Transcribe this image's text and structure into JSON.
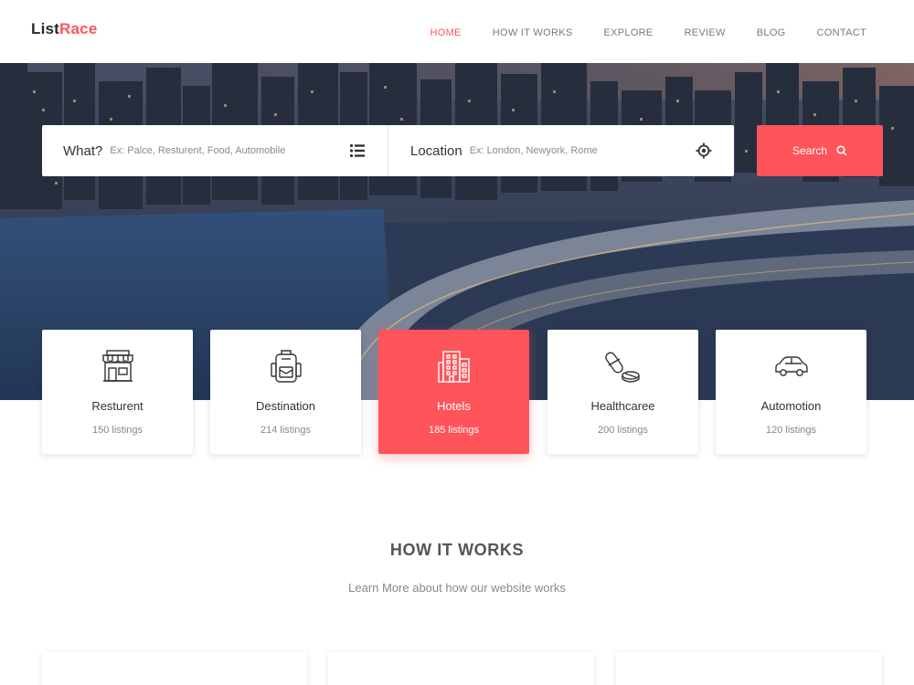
{
  "brand": {
    "part1": "List",
    "part2": "Race"
  },
  "nav": [
    {
      "label": "HOME",
      "active": true
    },
    {
      "label": "HOW IT WORKS",
      "active": false
    },
    {
      "label": "EXPLORE",
      "active": false
    },
    {
      "label": "REVIEW",
      "active": false
    },
    {
      "label": "BLOG",
      "active": false
    },
    {
      "label": "CONTACT",
      "active": false
    }
  ],
  "search": {
    "what_label": "What?",
    "what_placeholder": "Ex: Palce, Resturent, Food, Automobile",
    "what_icon": "list-icon",
    "location_label": "Location",
    "location_placeholder": "Ex: London, Newyork, Rome",
    "location_icon": "crosshair-icon",
    "button_label": "Search",
    "button_icon": "search-icon"
  },
  "categories": [
    {
      "name": "Resturent",
      "count": "150 listings",
      "icon": "shop-icon",
      "active": false
    },
    {
      "name": "Destination",
      "count": "214 listings",
      "icon": "backpack-icon",
      "active": false
    },
    {
      "name": "Hotels",
      "count": "185 listings",
      "icon": "building-icon",
      "active": true
    },
    {
      "name": "Healthcaree",
      "count": "200 listings",
      "icon": "pills-icon",
      "active": false
    },
    {
      "name": "Automotion",
      "count": "120 listings",
      "icon": "car-icon",
      "active": false
    }
  ],
  "how_it_works": {
    "title": "HOW IT WORKS",
    "subtitle": "Learn More about how our website works"
  },
  "colors": {
    "accent": "#ff545a",
    "text": "#333333",
    "muted": "#888888"
  }
}
